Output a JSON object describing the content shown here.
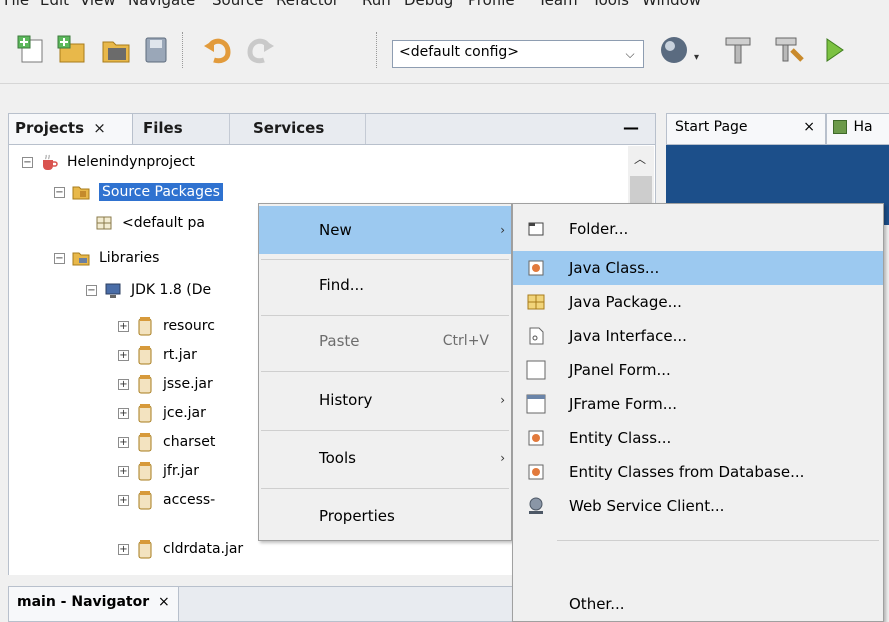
{
  "menubar": [
    "File",
    "Edit",
    "View",
    "Navigate",
    "Source",
    "Refactor",
    "Run",
    "Debug",
    "Profile",
    "Team",
    "Tools",
    "Window"
  ],
  "toolbar": {
    "config_value": "<default config>",
    "icons": [
      "new-file-icon",
      "new-project-icon",
      "open-project-icon",
      "save-all-icon",
      "undo-icon",
      "redo-icon",
      "globe-icon",
      "build-hammer-icon",
      "clean-build-icon",
      "run-icon"
    ]
  },
  "projects_panel": {
    "tabs": [
      "Projects",
      "Files",
      "Services"
    ],
    "close_glyph": "×",
    "minimize_glyph": "—",
    "tree": [
      {
        "label": "Helenindynproject",
        "icon": "coffee-cup-icon"
      },
      {
        "label": "Source Packages",
        "icon": "source-packages-icon"
      },
      {
        "label": "<default pa",
        "icon": "package-icon"
      },
      {
        "label": "Libraries",
        "icon": "libraries-icon"
      },
      {
        "label": "JDK 1.8 (De",
        "icon": "jdk-icon"
      },
      {
        "label": "resourc",
        "icon": "jar-icon"
      },
      {
        "label": "rt.jar",
        "icon": "jar-icon"
      },
      {
        "label": "jsse.jar",
        "icon": "jar-icon"
      },
      {
        "label": "jce.jar",
        "icon": "jar-icon"
      },
      {
        "label": "charset",
        "icon": "jar-icon"
      },
      {
        "label": "jfr.jar",
        "icon": "jar-icon"
      },
      {
        "label": "access-",
        "icon": "jar-icon"
      },
      {
        "label": "cldrdata.jar",
        "icon": "jar-icon"
      }
    ]
  },
  "navigator_panel": {
    "title": "main - Navigator",
    "close_glyph": "×"
  },
  "editor_tabs": {
    "start_page": "Start Page",
    "close_glyph": "×",
    "second_tab": "Ha"
  },
  "context_menu": {
    "items": [
      {
        "label": "New",
        "shortcut": "",
        "submenu": true,
        "highlighted": true
      },
      {
        "label": "Find...",
        "shortcut": "",
        "submenu": false
      },
      {
        "label": "Paste",
        "shortcut": "Ctrl+V",
        "submenu": false,
        "disabled": true
      },
      {
        "label": "History",
        "shortcut": "",
        "submenu": true
      },
      {
        "label": "Tools",
        "shortcut": "",
        "submenu": true
      },
      {
        "label": "Properties",
        "shortcut": "",
        "submenu": false
      }
    ]
  },
  "new_submenu": {
    "items": [
      {
        "label": "Folder...",
        "icon": "folder-icon"
      },
      {
        "label": "Java Class...",
        "icon": "java-class-icon",
        "highlighted": true
      },
      {
        "label": "Java Package...",
        "icon": "java-package-icon"
      },
      {
        "label": "Java Interface...",
        "icon": "java-interface-icon"
      },
      {
        "label": "JPanel Form...",
        "icon": "jpanel-form-icon"
      },
      {
        "label": "JFrame Form...",
        "icon": "jframe-form-icon"
      },
      {
        "label": "Entity Class...",
        "icon": "entity-class-icon"
      },
      {
        "label": "Entity Classes from Database...",
        "icon": "entity-database-icon"
      },
      {
        "label": "Web Service Client...",
        "icon": "web-service-icon"
      },
      {
        "label": "Other...",
        "icon": ""
      }
    ]
  },
  "colors": {
    "selection": "#2f72d0",
    "menu_highlight": "#9cc9f0",
    "editor_bg": "#1c4f8a"
  }
}
